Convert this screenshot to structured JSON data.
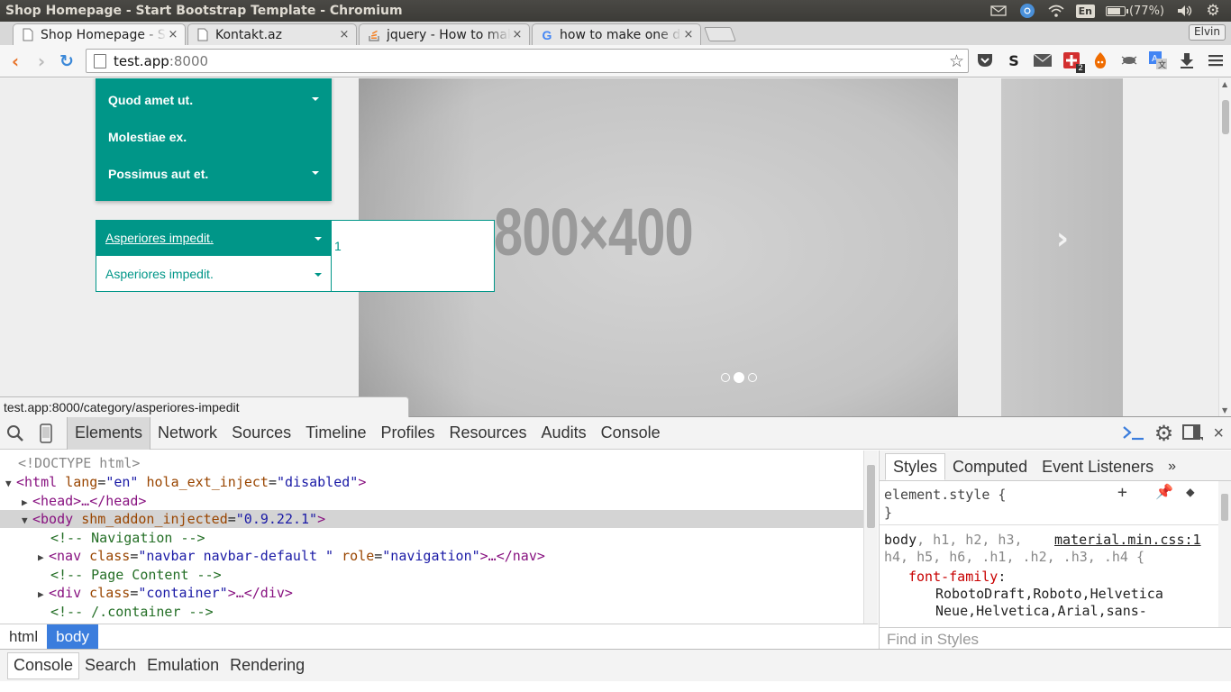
{
  "os": {
    "window_title": "Shop Homepage - Start Bootstrap Template - Chromium",
    "lang": "En",
    "battery_text": "(77%)",
    "battery_level": 0.77
  },
  "browser": {
    "tabs": [
      {
        "label": "Shop Homepage - Start Bootstrap Template",
        "favicon": "page-icon",
        "close": "×"
      },
      {
        "label": "Kontakt.az",
        "favicon": "page-icon",
        "close": "×"
      },
      {
        "label": "jquery - How to make one div",
        "favicon": "stackoverflow-icon",
        "close": "×"
      },
      {
        "label": "how to make one div",
        "favicon": "google-icon",
        "close": "×"
      }
    ],
    "profile_name": "Elvin",
    "url_host": "test.app",
    "url_port": ":8000",
    "status_url": "test.app:8000/category/asperiores-impedit",
    "ext_badge": "2"
  },
  "page": {
    "menu_items": [
      {
        "label": "Quod amet ut.",
        "has_caret": true
      },
      {
        "label": "Molestiae ex.",
        "has_caret": false
      },
      {
        "label": "Possimus aut et.",
        "has_caret": true
      }
    ],
    "category_active": "Asperiores impedit.",
    "category_second": "Asperiores impedit.",
    "submenu_text": "1",
    "slide_text": "800×400",
    "accent": "#009688"
  },
  "devtools": {
    "tabs": [
      "Elements",
      "Network",
      "Sources",
      "Timeline",
      "Profiles",
      "Resources",
      "Audits",
      "Console"
    ],
    "dom": {
      "doctype": "<!DOCTYPE html>",
      "html_open_tag": "<html",
      "html_attr1_name": "lang",
      "html_attr1_val": "\"en\"",
      "html_attr2_name": "hola_ext_inject",
      "html_attr2_val": "\"disabled\"",
      "head": "<head>…</head>",
      "body_open_tag": "<body",
      "body_attr_name": "shm_addon_injected",
      "body_attr_val": "\"0.9.22.1\"",
      "comment_nav": "<!-- Navigation -->",
      "nav_tag": "<nav",
      "nav_class_name": "class",
      "nav_class_val": "\"navbar navbar-default \"",
      "nav_role_name": "role",
      "nav_role_val": "\"navigation\"",
      "nav_rest": ">…</nav>",
      "comment_content": "<!-- Page Content -->",
      "div_tag": "<div",
      "div_class_name": "class",
      "div_class_val": "\"container\"",
      "div_rest": ">…</div>",
      "comment_container": "<!-- /.container -->"
    },
    "breadcrumbs": [
      "html",
      "body"
    ],
    "styles_tabs": [
      "Styles",
      "Computed",
      "Event Listeners"
    ],
    "styles": {
      "element_style": "element.style {",
      "close_brace": "}",
      "rule_selector_main": "body",
      "rule_selector_dim": ", h1, h2, h3,",
      "rule_selector_line2": "h4, h5, h6, .h1, .h2, .h3, .h4 {",
      "source": "material.min.css:1",
      "prop": "font-family",
      "value_line1": "RobotoDraft,Roboto,Helvetica",
      "value_line2": "Neue,Helvetica,Arial,sans-"
    },
    "find_placeholder": "Find in Styles",
    "drawer_tabs": [
      "Console",
      "Search",
      "Emulation",
      "Rendering"
    ]
  }
}
